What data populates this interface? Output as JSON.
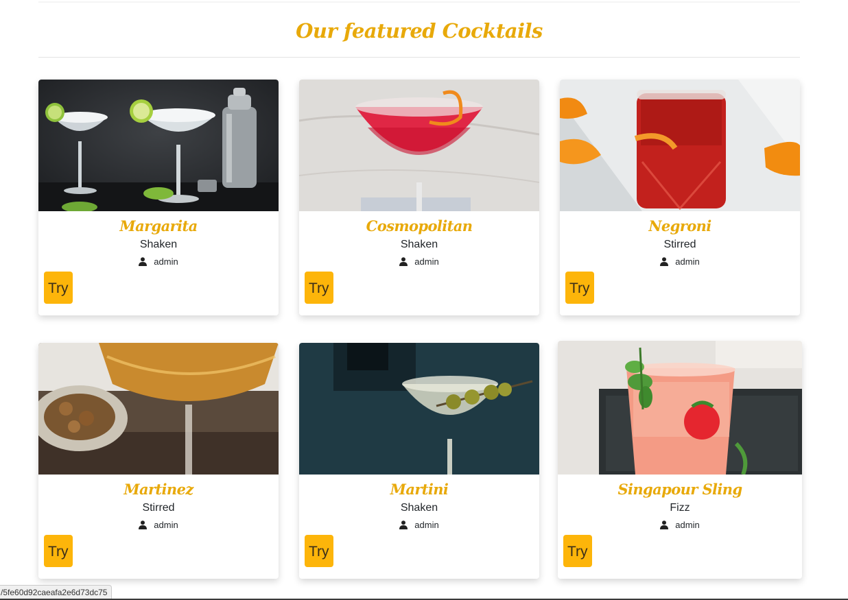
{
  "section": {
    "heading": "Our featured Cocktails"
  },
  "cocktails": [
    {
      "name": "Margarita",
      "method": "Shaken",
      "author": "admin",
      "button": "Try",
      "image": "margarita-photo"
    },
    {
      "name": "Cosmopolitan",
      "method": "Shaken",
      "author": "admin",
      "button": "Try",
      "image": "cosmopolitan-photo"
    },
    {
      "name": "Negroni",
      "method": "Stirred",
      "author": "admin",
      "button": "Try",
      "image": "negroni-photo"
    },
    {
      "name": "Martinez",
      "method": "Stirred",
      "author": "admin",
      "button": "Try",
      "image": "martinez-photo"
    },
    {
      "name": "Martini",
      "method": "Shaken",
      "author": "admin",
      "button": "Try",
      "image": "martini-photo"
    },
    {
      "name": "Singapour Sling",
      "method": "Fizz",
      "author": "admin",
      "button": "Try",
      "image": "singapore-sling-photo"
    }
  ],
  "status_bar": {
    "url": "/5fe60d92caeafa2e6d73dc75"
  },
  "colors": {
    "accent": "#e8a90a",
    "button": "#fdb50a"
  },
  "icons": {
    "author": "user-icon"
  }
}
